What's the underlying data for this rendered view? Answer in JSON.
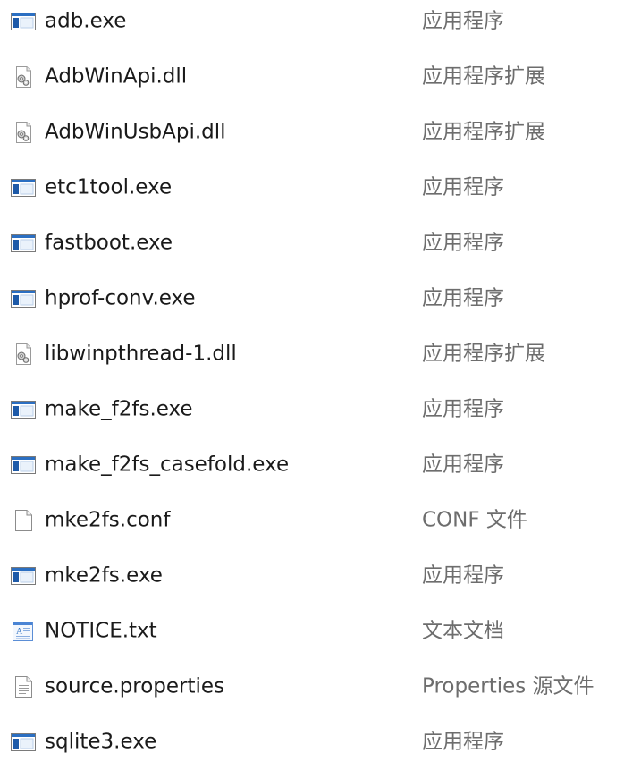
{
  "files": [
    {
      "name": "adb.exe",
      "type": "应用程序",
      "icon": "exe-icon"
    },
    {
      "name": "AdbWinApi.dll",
      "type": "应用程序扩展",
      "icon": "dll-icon"
    },
    {
      "name": "AdbWinUsbApi.dll",
      "type": "应用程序扩展",
      "icon": "dll-icon"
    },
    {
      "name": "etc1tool.exe",
      "type": "应用程序",
      "icon": "exe-icon"
    },
    {
      "name": "fastboot.exe",
      "type": "应用程序",
      "icon": "exe-icon"
    },
    {
      "name": "hprof-conv.exe",
      "type": "应用程序",
      "icon": "exe-icon"
    },
    {
      "name": "libwinpthread-1.dll",
      "type": "应用程序扩展",
      "icon": "dll-icon"
    },
    {
      "name": "make_f2fs.exe",
      "type": "应用程序",
      "icon": "exe-icon"
    },
    {
      "name": "make_f2fs_casefold.exe",
      "type": "应用程序",
      "icon": "exe-icon"
    },
    {
      "name": "mke2fs.conf",
      "type": "CONF 文件",
      "icon": "blank-file-icon"
    },
    {
      "name": "mke2fs.exe",
      "type": "应用程序",
      "icon": "exe-icon"
    },
    {
      "name": "NOTICE.txt",
      "type": "文本文档",
      "icon": "text-document-icon"
    },
    {
      "name": "source.properties",
      "type": "Properties 源文件",
      "icon": "properties-file-icon"
    },
    {
      "name": "sqlite3.exe",
      "type": "应用程序",
      "icon": "exe-icon"
    }
  ]
}
